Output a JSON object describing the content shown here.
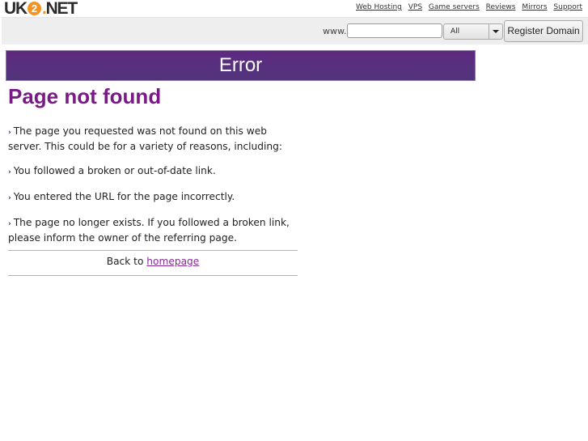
{
  "header": {
    "logo": {
      "prefix": "UK",
      "badge": "2",
      "dot": ".",
      "suffix": "NET"
    },
    "nav_links": [
      "Web Hosting",
      "VPS",
      "Game servers",
      "Reviews",
      "Mirrors",
      "Support"
    ]
  },
  "domain_search": {
    "prefix_label": "www.",
    "input_value": "",
    "tld_selected": "All",
    "submit_label": "Register Domain"
  },
  "banner": {
    "title": "Error"
  },
  "main": {
    "heading": "Page not found",
    "bullet_glyph": "›",
    "paragraphs": [
      "The page you requested was not found on this web server. This could be for a variety of reasons, including:",
      "You followed a broken or out-of-date link.",
      "You entered the URL for the page incorrectly.",
      "The page no longer exists. If you followed a broken link, please inform the owner of the referring page."
    ],
    "back_text": "Back to",
    "back_link": "homepage"
  },
  "colors": {
    "brand_orange": "#f39322",
    "banner_purple": "#5a2d7f",
    "heading_purple": "#7a1a86"
  }
}
